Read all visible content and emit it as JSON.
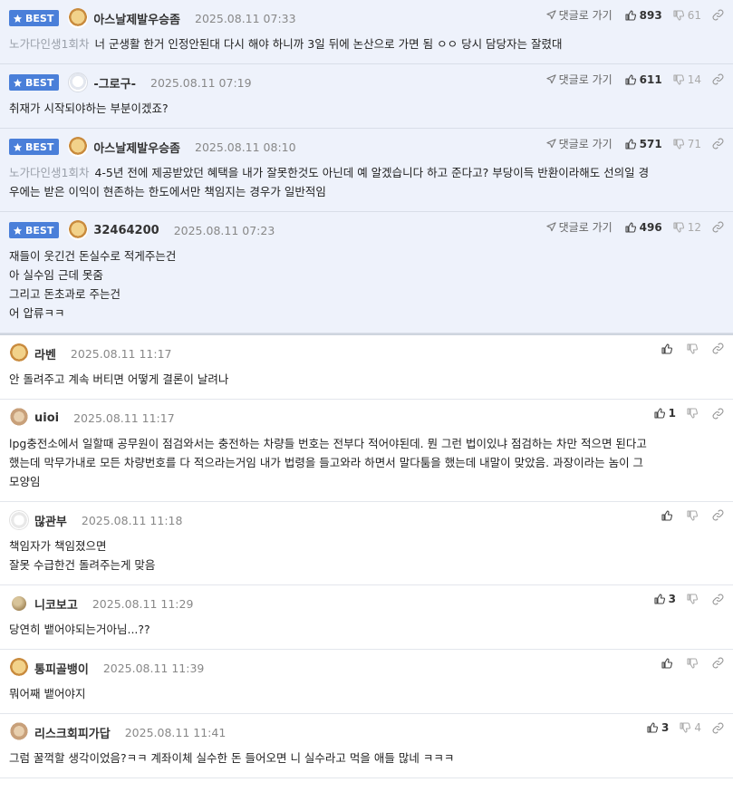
{
  "labels": {
    "best": "BEST",
    "goto_reply": "댓글로 가기"
  },
  "colors": {
    "best_bg": "#eef2fb",
    "badge": "#4a7fd9"
  },
  "best_comments": [
    {
      "nick": "아스날제발우승좀",
      "date": "2025.08.11 07:33",
      "up": "893",
      "down": "61",
      "reply_to": "노가다인생1회차",
      "lines": [
        "너 군생활 한거 인정안된대 다시 해야 하니까 3일 뒤에 논산으로 가면 됨 ㅇㅇ 당시 담당자는 잘렸대"
      ]
    },
    {
      "nick": "-그로구-",
      "date": "2025.08.11 07:19",
      "up": "611",
      "down": "14",
      "reply_to": "",
      "lines": [
        "취재가 시작되야하는 부분이겠죠?"
      ]
    },
    {
      "nick": "아스날제발우승좀",
      "date": "2025.08.11 08:10",
      "up": "571",
      "down": "71",
      "reply_to": "노가다인생1회차",
      "lines": [
        "4-5년 전에 제공받았던 혜택을 내가 잘못한것도 아닌데 예 알겠습니다 하고 준다고? 부당이득 반환이라해도 선의일 경",
        "우에는 받은 이익이 현존하는 한도에서만 책임지는 경우가 일반적임"
      ]
    },
    {
      "nick": "32464200",
      "date": "2025.08.11 07:23",
      "up": "496",
      "down": "12",
      "reply_to": "",
      "lines": [
        "재들이 웃긴건 돈실수로 적게주는건",
        "아 실수임 근데 못줌",
        "그리고 돈초과로 주는건",
        "어 압류ㅋㅋ"
      ]
    }
  ],
  "comments": [
    {
      "nick": "라벤",
      "date": "2025.08.11 11:17",
      "up": "",
      "down": "",
      "lines": [
        "안 돌려주고 계속 버티면 어떻게 결론이 날려나"
      ]
    },
    {
      "nick": "uioi",
      "date": "2025.08.11 11:17",
      "up": "1",
      "down": "",
      "lines": [
        "lpg충전소에서 일할때 공무원이 점검와서는 충전하는 차량들 번호는 전부다 적어야된데. 뭔 그런 법이있냐 점검하는 차만 적으면 된다고",
        "했는데 막무가내로 모든 차량번호를 다 적으라는거임 내가 법령을 들고와라 하면서 말다툼을 했는데 내말이 맞았음. 과장이라는 놈이 그",
        "모양임"
      ]
    },
    {
      "nick": "많관부",
      "date": "2025.08.11 11:18",
      "up": "",
      "down": "",
      "lines": [
        "책임자가 책임졌으면",
        "잘못 수급한건 돌려주는게 맞음"
      ]
    },
    {
      "nick": "니코보고",
      "date": "2025.08.11 11:29",
      "up": "3",
      "down": "",
      "lines": [
        "당연히 뱉어야되는거아님...??"
      ]
    },
    {
      "nick": "통피골뱅이",
      "date": "2025.08.11 11:39",
      "up": "",
      "down": "",
      "lines": [
        "뭐어째 뱉어야지"
      ]
    },
    {
      "nick": "리스크회피가답",
      "date": "2025.08.11 11:41",
      "up": "3",
      "down": "4",
      "lines": [
        "그럼 꿀꺽할 생각이었음?ㅋㅋ 계좌이체 실수한 돈 들어오면 니 실수라고 먹을 애들 많네 ㅋㅋㅋ"
      ]
    }
  ]
}
